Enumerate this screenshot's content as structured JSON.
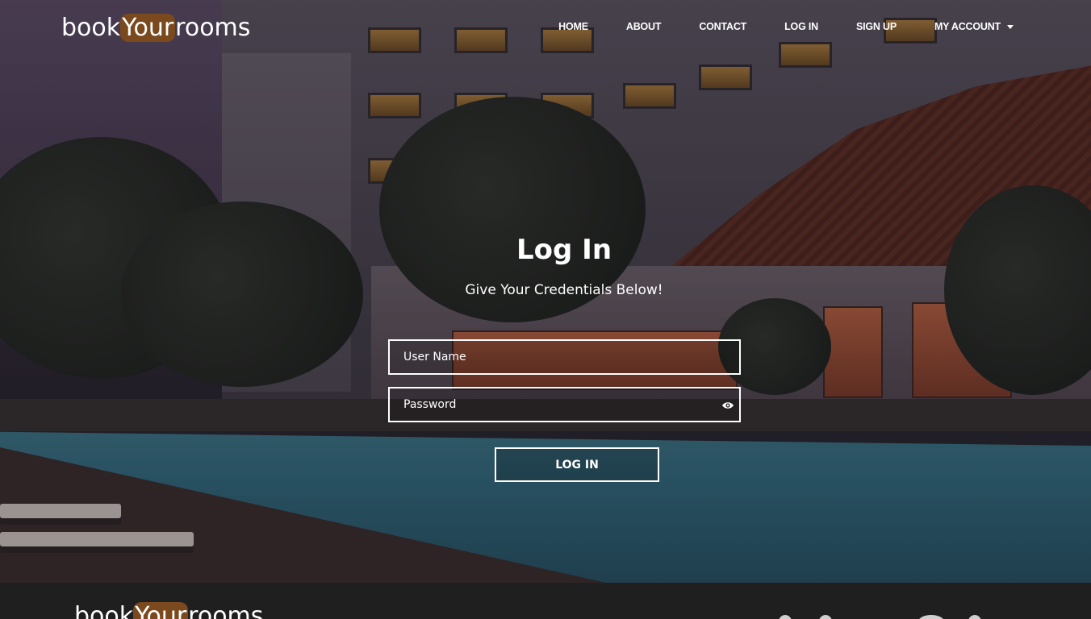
{
  "brand": {
    "part1": "book",
    "part2": "Your",
    "part3": "rooms",
    "accent": "#7a4a1e"
  },
  "nav": {
    "items": [
      {
        "label": "HOME"
      },
      {
        "label": "ABOUT"
      },
      {
        "label": "CONTACT"
      },
      {
        "label": "LOG IN"
      },
      {
        "label": "SIGN UP"
      },
      {
        "label": "MY ACCOUNT"
      }
    ],
    "dropdown_icon": "caret-down-icon"
  },
  "login": {
    "title": "Log In",
    "subtitle": "Give Your Credentials Below!",
    "username_placeholder": "User Name",
    "password_placeholder": "Password",
    "show_password_icon": "eye-icon",
    "button_label": "LOG IN"
  },
  "footer": {
    "brand": {
      "part1": "book",
      "part2": "Your",
      "part3": "rooms"
    }
  },
  "colors": {
    "footer_bg": "#1f1f20",
    "text": "#ffffff"
  }
}
